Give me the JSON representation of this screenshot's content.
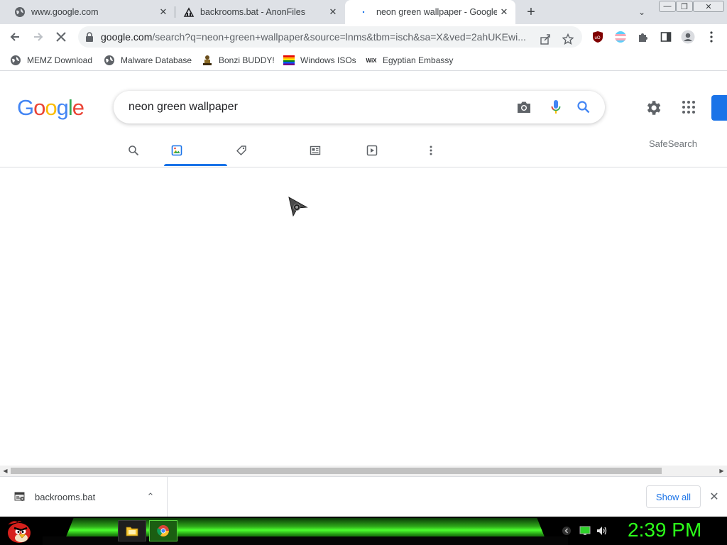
{
  "tabs": [
    {
      "title": "www.google.com",
      "close": "✕"
    },
    {
      "title": "backrooms.bat - AnonFiles",
      "close": "✕"
    },
    {
      "title": "neon green wallpaper - Google S",
      "close": "✕"
    }
  ],
  "new_tab": "+",
  "tab_search": "⌄",
  "window_controls": {
    "minimize": "—",
    "maximize": "❐",
    "close": "✕"
  },
  "toolbar": {
    "url_host": "google.com",
    "url_path": "/search?q=neon+green+wallpaper&source=lnms&tbm=isch&sa=X&ved=2ahUKEwi..."
  },
  "bookmarks": [
    {
      "label": "MEMZ Download",
      "icon": "globe-icon"
    },
    {
      "label": "Malware Database",
      "icon": "globe-icon"
    },
    {
      "label": "Bonzi BUDDY!",
      "icon": "bonzi-icon"
    },
    {
      "label": "Windows ISOs",
      "icon": "rainbow-flag-icon"
    },
    {
      "label": "Egyptian Embassy",
      "icon": "wix-icon"
    }
  ],
  "bookmark_wix": "WiX",
  "google": {
    "logo_letters": [
      "G",
      "o",
      "o",
      "g",
      "l",
      "e"
    ],
    "logo_colors": [
      "#4285F4",
      "#EA4335",
      "#FBBC05",
      "#4285F4",
      "#34A853",
      "#EA4335"
    ],
    "query": "neon green wallpaper",
    "safesearch": "SafeSearch"
  },
  "downloads": {
    "file": "backrooms.bat",
    "show_all": "Show all",
    "close": "✕",
    "chevron": "⌃"
  },
  "taskbar": {
    "clock": "2:39 PM"
  },
  "colors": {
    "accent": "#1a73e8",
    "taskbar_green": "#2cff1a"
  }
}
